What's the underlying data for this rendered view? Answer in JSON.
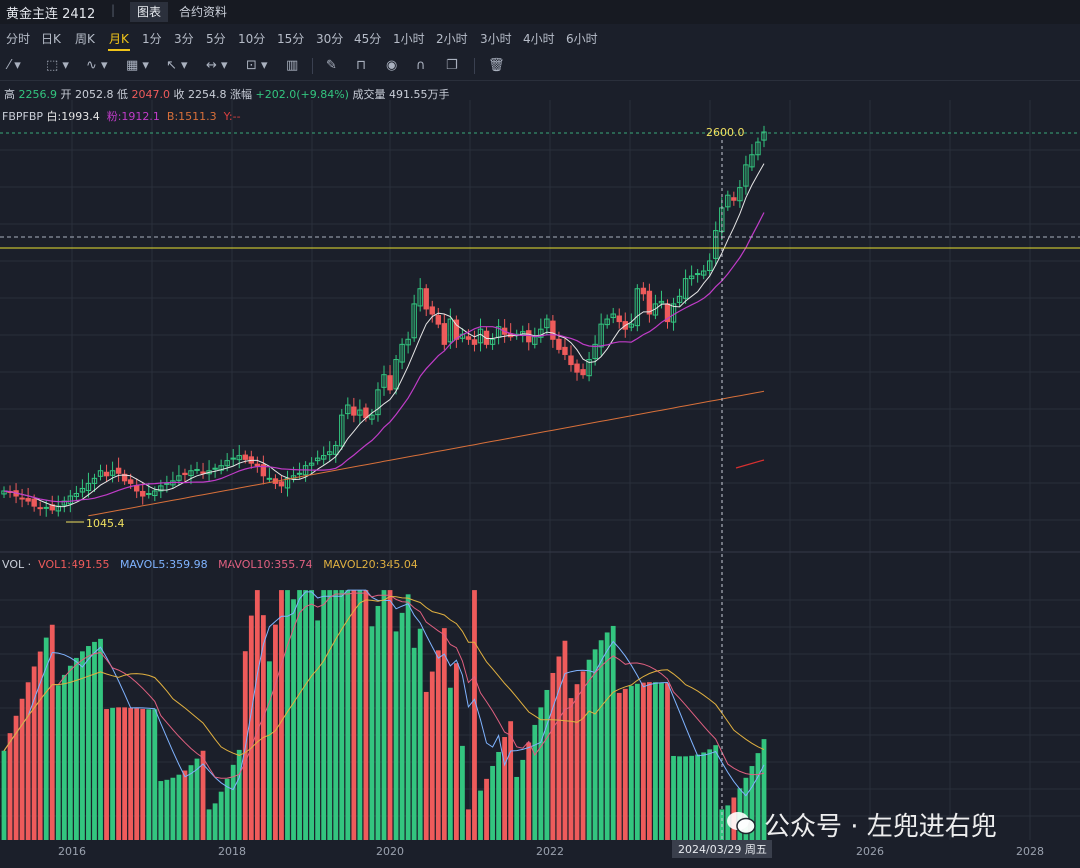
{
  "header": {
    "title": "黄金主连 2412",
    "separator": "|",
    "tabs": [
      {
        "label": "图表",
        "active": true
      },
      {
        "label": "合约资料",
        "active": false
      }
    ]
  },
  "periods": [
    "分时",
    "日K",
    "周K",
    "月K",
    "1分",
    "3分",
    "5分",
    "10分",
    "15分",
    "30分",
    "45分",
    "1小时",
    "2小时",
    "3小时",
    "4小时",
    "6小时"
  ],
  "active_period": "月K",
  "toolbar_icons": [
    "line-tool-icon",
    "rectangle-tool-icon",
    "pattern-tool-icon",
    "grid-tool-icon",
    "arrow-tool-icon",
    "measure-tool-icon",
    "text-tool-icon",
    "chart-tool-icon",
    "pen-icon",
    "lock-icon",
    "eye-icon",
    "magnet-icon",
    "layers-icon",
    "trash-icon"
  ],
  "ohlc": {
    "high_label": "高",
    "high": "2256.9",
    "open_label": "开",
    "open": "2052.8",
    "low_label": "低",
    "low": "2047.0",
    "close_label": "收",
    "close": "2254.8",
    "change_label": "涨幅",
    "change": "+202.0(+9.84%)",
    "volume_label": "成交量",
    "volume": "491.55万手"
  },
  "indicators": {
    "name": "FBPFBP",
    "white": "白:1993.4",
    "pink": "粉:1912.1",
    "b": "B:1511.3",
    "y": "Y:--"
  },
  "volume_header": {
    "name": "VOL",
    "vol1": "VOL1:491.55",
    "mavol5": "MAVOL5:359.98",
    "mavol10": "MAVOL10:355.74",
    "mavol20": "MAVOL20:345.04"
  },
  "annotations": {
    "high_price": "2600.0",
    "low_price": "1045.4",
    "crosshair_date": "2024/03/29 周五"
  },
  "x_axis_labels": [
    "2016",
    "2018",
    "2020",
    "2022",
    "2024",
    "2026",
    "2028"
  ],
  "watermark": "公众号 · 左兜进右兜",
  "colors": {
    "background": "#1b1f2a",
    "up": "#33c57f",
    "down": "#ee5b5b",
    "ma_white": "#e6e6e6",
    "ma_pink": "#c03cc8",
    "ma_b": "#d8703a",
    "accent": "#f0c419"
  },
  "chart_data": {
    "type": "candlestick",
    "period": "monthly",
    "x_start": "2015-06",
    "price_range": [
      950,
      2650
    ],
    "candles_close_approx": [
      1180,
      1175,
      1160,
      1150,
      1140,
      1120,
      1110,
      1115,
      1105,
      1120,
      1140,
      1160,
      1170,
      1190,
      1210,
      1230,
      1260,
      1240,
      1260,
      1250,
      1220,
      1210,
      1180,
      1160,
      1170,
      1180,
      1200,
      1210,
      1220,
      1240,
      1245,
      1260,
      1265,
      1250,
      1260,
      1270,
      1280,
      1300,
      1310,
      1320,
      1305,
      1290,
      1280,
      1240,
      1230,
      1210,
      1200,
      1230,
      1240,
      1250,
      1280,
      1290,
      1310,
      1320,
      1335,
      1360,
      1480,
      1520,
      1480,
      1500,
      1470,
      1480,
      1580,
      1640,
      1580,
      1700,
      1760,
      1780,
      1920,
      1980,
      1900,
      1880,
      1840,
      1760,
      1860,
      1780,
      1800,
      1780,
      1760,
      1820,
      1760,
      1780,
      1830,
      1800,
      1790,
      1800,
      1810,
      1770,
      1790,
      1820,
      1860,
      1780,
      1740,
      1720,
      1680,
      1650,
      1640,
      1700,
      1760,
      1840,
      1860,
      1880,
      1850,
      1820,
      1840,
      1980,
      1960,
      1880,
      1920,
      1930,
      1850,
      1920,
      1950,
      2020,
      2030,
      2040,
      2050,
      2090,
      2210,
      2300,
      2350,
      2330,
      2380,
      2470,
      2510,
      2560,
      2600
    ],
    "annotations": {
      "max": 2600.0,
      "min": 1045.4
    },
    "x_ticks": [
      "2016",
      "2018",
      "2020",
      "2022",
      "2024",
      "2026",
      "2028"
    ]
  }
}
